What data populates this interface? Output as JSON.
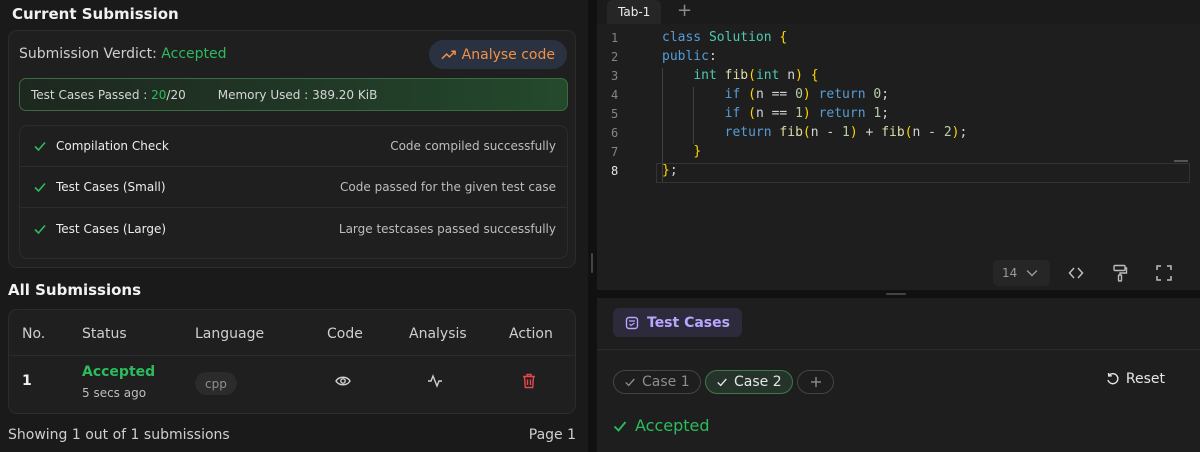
{
  "current_submission": {
    "title": "Current Submission",
    "verdict_label": "Submission Verdict:",
    "verdict_value": "Accepted",
    "analyse_button": "Analyse code",
    "tests_passed_label": "Test Cases Passed :",
    "tests_passed_count": "20",
    "tests_total": "/20",
    "memory_label": "Memory Used :",
    "memory_value": "389.20 KiB",
    "checks": [
      {
        "name": "Compilation Check",
        "desc": "Code compiled successfully"
      },
      {
        "name": "Test Cases (Small)",
        "desc": "Code passed for the given test case"
      },
      {
        "name": "Test Cases (Large)",
        "desc": "Large testcases passed successfully"
      }
    ]
  },
  "all_submissions": {
    "title": "All Submissions",
    "columns": [
      "No.",
      "Status",
      "Language",
      "Code",
      "Analysis",
      "Action"
    ],
    "rows": [
      {
        "no": "1",
        "status": "Accepted",
        "time": "5 secs ago",
        "language": "cpp"
      }
    ],
    "footer_left": "Showing 1 out of 1 submissions",
    "footer_right": "Page 1"
  },
  "editor": {
    "tabs": [
      {
        "label": "Tab-1"
      }
    ],
    "add_tab": "+",
    "line_numbers": [
      "1",
      "2",
      "3",
      "4",
      "5",
      "6",
      "7",
      "8"
    ],
    "code_lines": [
      "class Solution {",
      "public:",
      "    int fib(int n) {",
      "        if (n == 0) return 0;",
      "        if (n == 1) return 1;",
      "        return fib(n - 1) + fib(n - 2);",
      "    }",
      "};"
    ],
    "font_size": "14"
  },
  "test_cases": {
    "tab_label": "Test Cases",
    "cases": [
      {
        "label": "Case 1"
      },
      {
        "label": "Case 2"
      }
    ],
    "reset_label": "Reset",
    "result": "Accepted"
  },
  "colors": {
    "accepted_green": "#2cbb5d",
    "analyse_orange": "#f29046",
    "delete_red": "#e5484d",
    "testcase_purple": "#b9a6ff"
  }
}
